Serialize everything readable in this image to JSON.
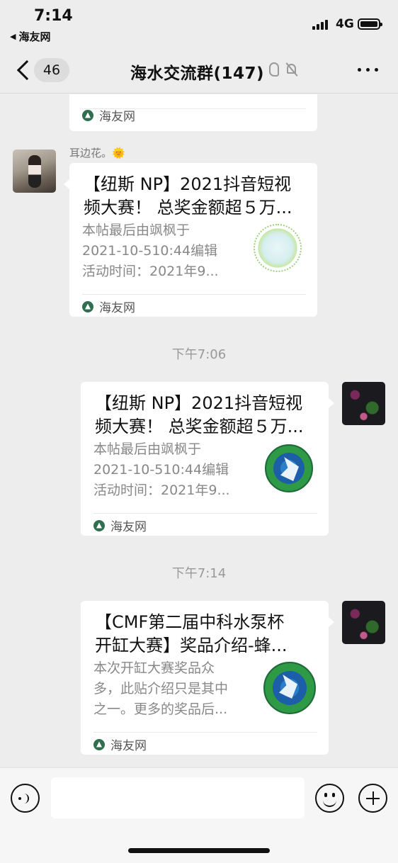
{
  "status_bar": {
    "time": "7:14",
    "back_app": "海友网",
    "network": "4G"
  },
  "nav": {
    "unread_count": "46",
    "title": "海水交流群(147)"
  },
  "messages": [
    {
      "type": "link-card-partial",
      "source": "海友网"
    },
    {
      "type": "link-card",
      "sender": "耳边花。🌞",
      "title_line1": "【纽斯 NP】2021抖音短视",
      "title_line2": "频大赛！ 总奖金额超５万...",
      "desc_line1": "本帖最后由飒枫于",
      "desc_line2": "2021-10-510:44编辑",
      "desc_line3": "活动时间：2021年9...",
      "source": "海友网"
    },
    {
      "type": "timestamp",
      "text": "下午7:06"
    },
    {
      "type": "link-card",
      "title_line1": "【纽斯 NP】2021抖音短视",
      "title_line2": "频大赛！ 总奖金额超５万...",
      "desc_line1": "本帖最后由飒枫于",
      "desc_line2": "2021-10-510:44编辑",
      "desc_line3": "活动时间：2021年9...",
      "source": "海友网"
    },
    {
      "type": "timestamp",
      "text": "下午7:14"
    },
    {
      "type": "link-card",
      "title_line1": "【CMF第二届中科水泵杯",
      "title_line2": "开缸大赛】奖品介绍-蜂...",
      "desc_line1": "本次开缸大赛奖品众",
      "desc_line2": "多，此贴介绍只是其中",
      "desc_line3": "之一。更多的奖品后...",
      "source": "海友网"
    }
  ],
  "input_bar": {
    "placeholder": ""
  },
  "icons": [
    "signal-icon",
    "battery-icon",
    "back-chevron-icon",
    "ear-icon",
    "mute-icon",
    "more-icon",
    "voice-icon",
    "emoji-icon",
    "plus-icon",
    "source-logo-icon"
  ]
}
